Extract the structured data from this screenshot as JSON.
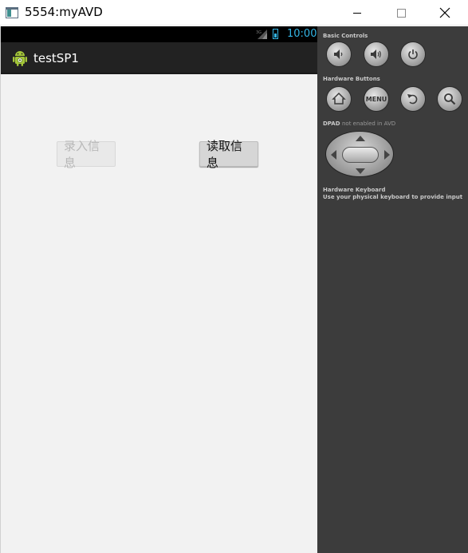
{
  "window": {
    "title": "5554:myAVD",
    "icon": "app-window-icon",
    "buttons": [
      "minimize-icon",
      "maximize-icon",
      "close-icon"
    ]
  },
  "status_bar": {
    "network": "3G",
    "time": "10:00",
    "accent_color": "#33b5e5"
  },
  "action_bar": {
    "icon": "android-robot-icon",
    "title": "testSP1"
  },
  "content": {
    "input_button_label": "录入信息",
    "read_button_label": "读取信息"
  },
  "controls": {
    "basic_controls_label": "Basic Controls",
    "hardware_buttons_label": "Hardware Buttons",
    "menu_label": "MENU",
    "dpad_label": "DPAD",
    "dpad_note": "not enabled in AVD",
    "keyboard_label": "Hardware Keyboard",
    "keyboard_hint": "Use your physical keyboard to provide input"
  }
}
